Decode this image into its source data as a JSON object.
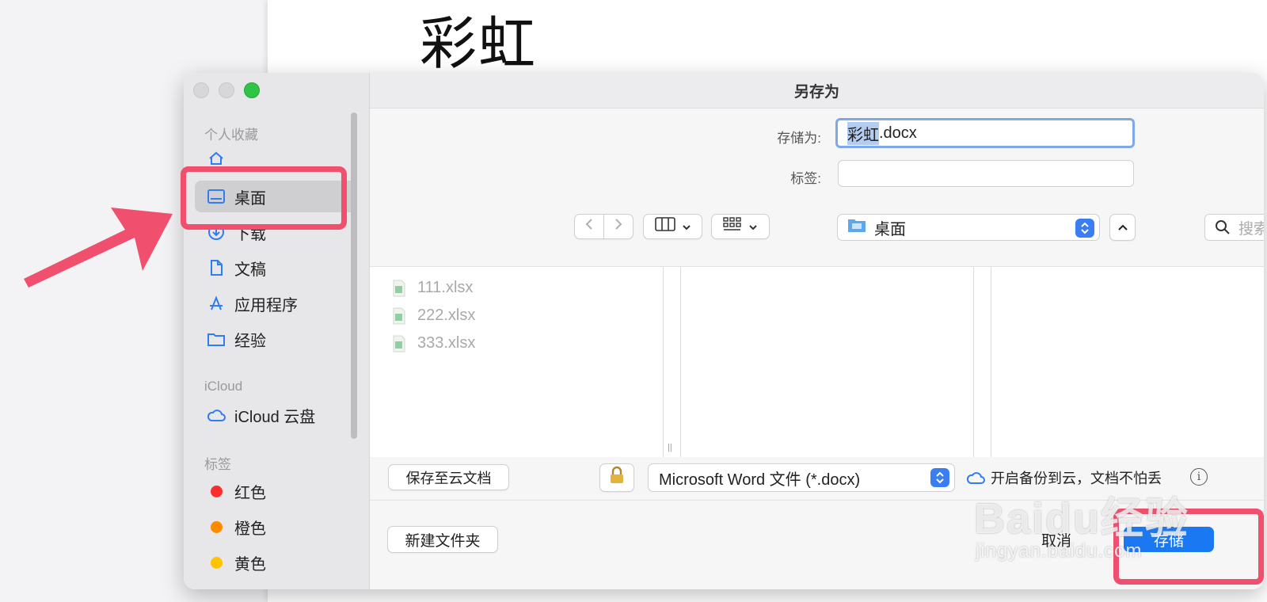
{
  "document": {
    "title": "彩虹"
  },
  "dialog": {
    "title": "另存为",
    "save_as_label": "存储为:",
    "filename_base": "彩虹",
    "filename_ext": ".docx",
    "tags_label": "标签:",
    "tags_value": "",
    "location": "桌面",
    "search_placeholder": "搜索",
    "files": [
      "111.xlsx",
      "222.xlsx",
      "333.xlsx"
    ],
    "save_to_cloud": "保存至云文档",
    "format": "Microsoft Word 文件 (*.docx)",
    "backup_text": "开启备份到云，文档不怕丢",
    "new_folder": "新建文件夹",
    "cancel": "取消",
    "save": "存储"
  },
  "sidebar": {
    "favorites_header": "个人收藏",
    "favorites": [
      {
        "label": "",
        "icon": "home-icon"
      },
      {
        "label": "桌面",
        "icon": "desktop-icon",
        "selected": true
      },
      {
        "label": "下载",
        "icon": "download-icon"
      },
      {
        "label": "文稿",
        "icon": "document-icon"
      },
      {
        "label": "应用程序",
        "icon": "apps-icon"
      },
      {
        "label": "经验",
        "icon": "folder-icon"
      }
    ],
    "icloud_header": "iCloud",
    "icloud_item": "iCloud 云盘",
    "tags_header": "标签",
    "tags": [
      {
        "label": "红色",
        "color": "#ff2d2d"
      },
      {
        "label": "橙色",
        "color": "#ff8a00"
      },
      {
        "label": "黄色",
        "color": "#ffc300"
      }
    ]
  },
  "watermark": {
    "brand": "Baidu经验",
    "url": "jingyan.baidu.com"
  },
  "colors": {
    "accent": "#1a78f2",
    "highlight": "#f0506e"
  }
}
